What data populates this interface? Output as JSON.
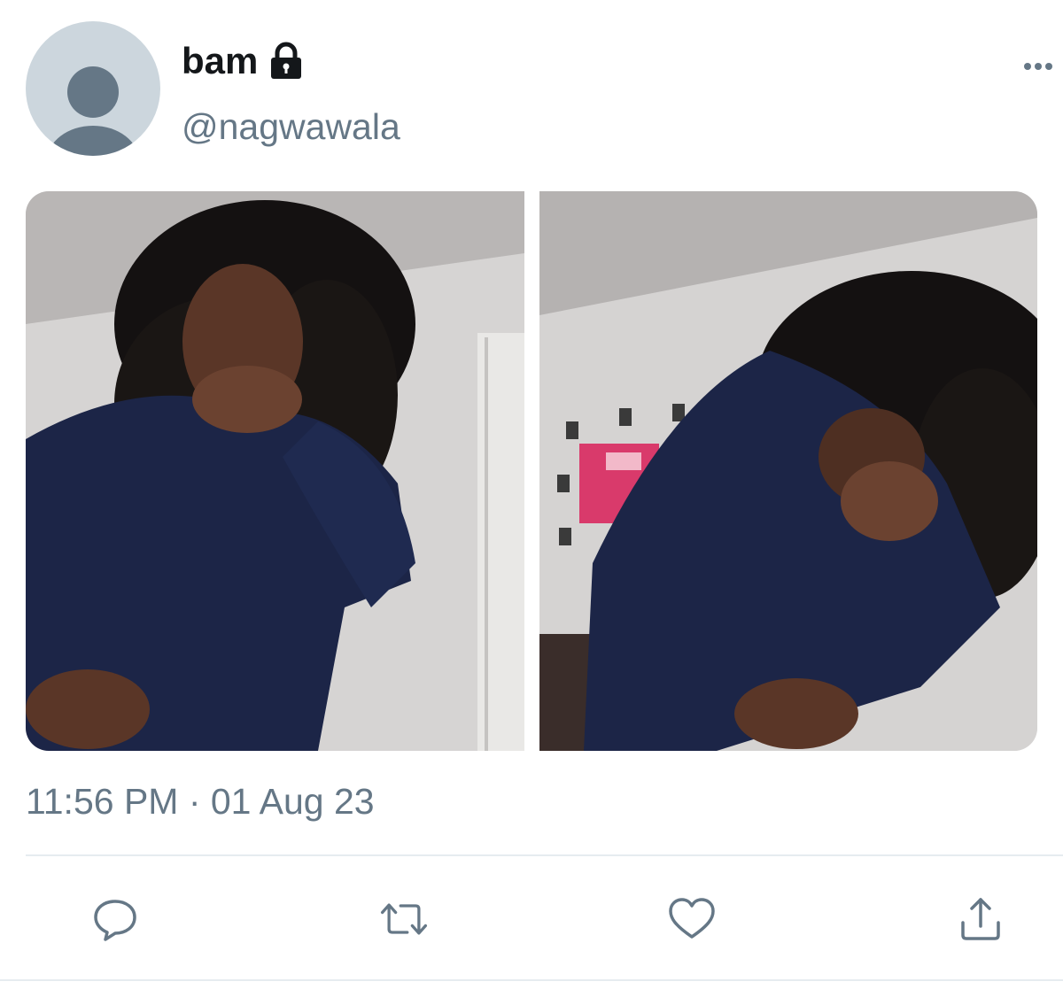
{
  "tweet": {
    "author": {
      "display_name": "bam",
      "handle": "@nagwawala",
      "protected_icon": "lock-icon",
      "avatar": "default-avatar"
    },
    "more_icon": "more-dots-icon",
    "media": [
      {
        "name": "photo-1",
        "description_icon": "photo"
      },
      {
        "name": "photo-2",
        "description_icon": "photo"
      }
    ],
    "timestamp": "11:56 PM · 01 Aug 23"
  },
  "actions": {
    "reply_icon": "reply-icon",
    "retweet_icon": "retweet-icon",
    "like_icon": "heart-icon",
    "share_icon": "share-icon"
  },
  "colors": {
    "text_primary": "#14171a",
    "text_secondary": "#657786",
    "avatar_bg": "#ccd6dd",
    "avatar_fg": "#657786",
    "divider": "#e6ecf0"
  }
}
